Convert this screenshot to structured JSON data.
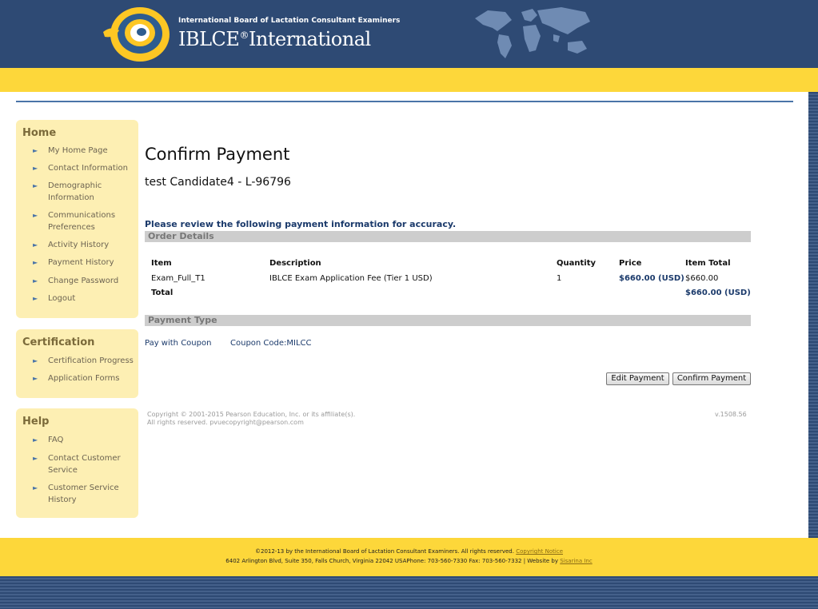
{
  "header": {
    "org_name": "International Board of Lactation Consultant Examiners",
    "brand_name": "IBLCE",
    "brand_suffix": "International",
    "reg_mark": "®"
  },
  "sidebar": {
    "home": {
      "title": "Home",
      "items": [
        "My Home Page",
        "Contact Information",
        "Demographic Information",
        "Communications Preferences",
        "Activity History",
        "Payment History",
        "Change Password",
        "Logout"
      ]
    },
    "certification": {
      "title": "Certification",
      "items": [
        "Certification Progress",
        "Application Forms"
      ]
    },
    "help": {
      "title": "Help",
      "items": [
        "FAQ",
        "Contact Customer Service",
        "Customer Service History"
      ]
    },
    "arrow": "►"
  },
  "main": {
    "title": "Confirm Payment",
    "candidate": "test Candidate4 - L-96796",
    "review_text": "Please review the following payment information for accuracy.",
    "order_details_label": "Order Details",
    "table": {
      "headers": [
        "Item",
        "Description",
        "Quantity",
        "Price",
        "Item Total"
      ],
      "rows": [
        {
          "item": "Exam_Full_T1",
          "description": "IBLCE Exam Application Fee (Tier 1 USD)",
          "quantity": "1",
          "price": "$660.00 (USD)",
          "item_total": "$660.00"
        }
      ],
      "total_label": "Total",
      "total_value": "$660.00 (USD)"
    },
    "payment_type_label": "Payment Type",
    "payment_method": "Pay with Coupon",
    "coupon_code": "Coupon Code:MILCC",
    "edit_button": "Edit Payment",
    "confirm_button": "Confirm Payment",
    "copyright_line1": "Copyright © 2001-2015 Pearson Education, Inc. or its affiliate(s).",
    "copyright_line2": "All rights reserved. pvuecopyright@pearson.com",
    "version": "v.1508.56"
  },
  "footer": {
    "line1_text": "©2012-13 by the International Board of Lactation Consultant Examiners. All rights reserved.",
    "line1_link": "Copyright Notice",
    "line2_text": "6402 Arlington Blvd, Suite 350, Falls Church, Virginia 22042 USAPhone: 703-560-7330 Fax: 703-560-7332 | Website by",
    "line2_link": "Sisarina Inc"
  },
  "colors": {
    "header_blue": "#2e4a74",
    "accent_yellow": "#fdd73a",
    "sidebar_bg": "#fdefb3",
    "heading_blue": "#1b3a6b"
  }
}
